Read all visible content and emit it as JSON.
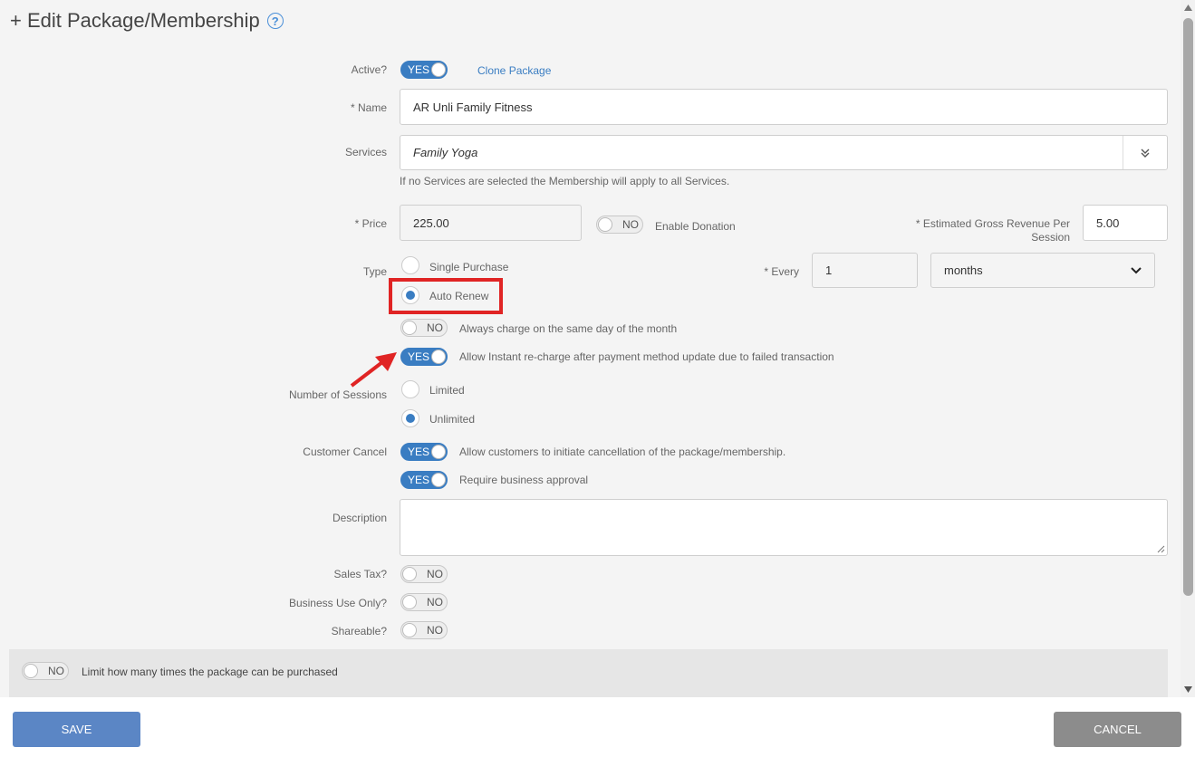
{
  "title": "+ Edit Package/Membership",
  "help_icon_glyph": "?",
  "active": {
    "label": "Active?",
    "toggle": "YES",
    "clone_link": "Clone Package"
  },
  "name": {
    "label": "* Name",
    "value": "AR Unli Family Fitness"
  },
  "services": {
    "label": "Services",
    "value": "Family Yoga",
    "hint": "If no Services are selected the Membership will apply to all Services."
  },
  "price": {
    "label": "* Price",
    "value": "225.00",
    "donation_toggle": "NO",
    "donation_label": "Enable Donation",
    "egr_label_1": "* Estimated Gross Revenue Per",
    "egr_label_2": "Session",
    "egr_value": "5.00"
  },
  "type": {
    "label": "Type",
    "options": [
      "Single Purchase",
      "Auto Renew"
    ],
    "selected": "Auto Renew",
    "every_label": "* Every",
    "every_value": "1",
    "period": "months"
  },
  "same_day": {
    "toggle": "NO",
    "label": "Always charge on the same day of the month"
  },
  "instant_recharge": {
    "toggle": "YES",
    "label": "Allow Instant re-charge after payment method update due to failed transaction"
  },
  "sessions": {
    "label": "Number of Sessions",
    "options": [
      "Limited",
      "Unlimited"
    ],
    "selected": "Unlimited"
  },
  "customer_cancel": {
    "label": "Customer Cancel",
    "toggle": "YES",
    "text": "Allow customers to initiate cancellation of the package/membership.",
    "approval_toggle": "YES",
    "approval_text": "Require business approval"
  },
  "description": {
    "label": "Description",
    "value": ""
  },
  "sales_tax": {
    "label": "Sales Tax?",
    "toggle": "NO"
  },
  "business_use": {
    "label": "Business Use Only?",
    "toggle": "NO"
  },
  "shareable": {
    "label": "Shareable?",
    "toggle": "NO"
  },
  "limit": {
    "toggle": "NO",
    "label": "Limit how many times the package can be purchased"
  },
  "footer": {
    "save": "SAVE",
    "cancel": "CANCEL"
  },
  "colors": {
    "accent": "#3a7dc2",
    "save_bg": "#5b86c5",
    "cancel_bg": "#8c8c8c",
    "highlight": "#e02424"
  }
}
